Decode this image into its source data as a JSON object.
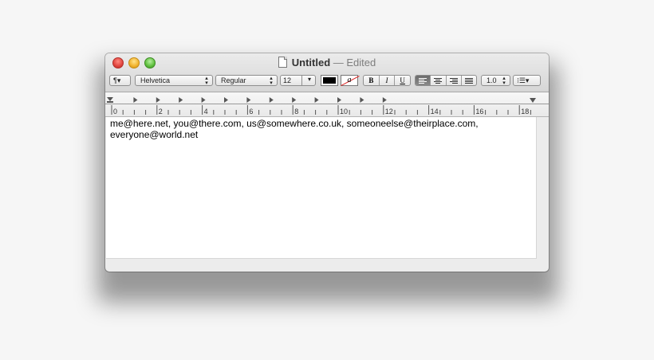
{
  "window": {
    "title": "Untitled",
    "status": "— Edited"
  },
  "toolbar": {
    "paragraph_label": "¶▾",
    "font_family": "Helvetica",
    "font_style": "Regular",
    "font_size": "12",
    "font_size_arrow": "▾",
    "text_color": "#000000",
    "highlight_label": "a",
    "bold": "B",
    "italic": "I",
    "underline": "U",
    "line_spacing": "1.0",
    "list_label": "⁝☰▾"
  },
  "ruler": {
    "labels": [
      "0",
      "2",
      "4",
      "6",
      "8",
      "10",
      "12",
      "14",
      "16",
      "18"
    ]
  },
  "editor": {
    "line1": "me@here.net, you@there.com, us@somewhere.co.uk, someoneelse@theirplace.com,",
    "line2": "everyone@world.net"
  }
}
